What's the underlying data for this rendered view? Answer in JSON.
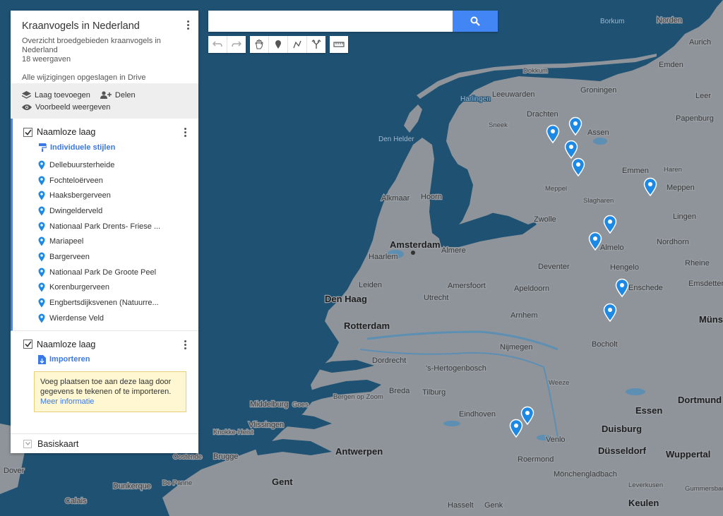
{
  "map": {
    "title": "Kraanvogels in Nederland",
    "description": "Overzicht broedgebieden kraanvogels in Nederland",
    "views": "18 weergaven",
    "saved_status": "Alle wijzigingen opgeslagen in Drive",
    "accent": "#4285f4",
    "marker_color": "#1e88e5"
  },
  "actions": {
    "add_layer": "Laag toevoegen",
    "share": "Delen",
    "preview": "Voorbeeld weergeven"
  },
  "layer1": {
    "name": "Naamloze laag",
    "style_link": "Individuele stijlen",
    "places": [
      "Dellebuursterheide",
      "Fochteloërveen",
      "Haaksbergerveen",
      "Dwingelderveld",
      "Nationaal Park Drents- Friese ...",
      "Mariapeel",
      "Bargerveen",
      "Nationaal Park De Groote Peel",
      "Korenburgerveen",
      "Engbertsdijksvenen (Natuurre...",
      "Wierdense Veld"
    ]
  },
  "layer2": {
    "name": "Naamloze laag",
    "import_link": "Importeren",
    "tip_text": "Voeg plaatsen toe aan deze laag door gegevens te tekenen of te importeren.",
    "tip_link": "Meer informatie"
  },
  "basemap": {
    "label": "Basiskaart"
  },
  "search": {
    "value": "",
    "placeholder": ""
  },
  "cities": {
    "amsterdam": "Amsterdam",
    "rotterdam": "Rotterdam",
    "den_haag": "Den Haag",
    "utrecht": "Utrecht",
    "leiden": "Leiden",
    "haarlem": "Haarlem",
    "almere": "Almere",
    "alkmaar": "Alkmaar",
    "hoorn": "Hoorn",
    "den_helder": "Den Helder",
    "leeuwarden": "Leeuwarden",
    "groningen": "Groningen",
    "drachten": "Drachten",
    "assen": "Assen",
    "emmen": "Emmen",
    "meppel": "Meppel",
    "zwolle": "Zwolle",
    "almelo": "Almelo",
    "hengelo": "Hengelo",
    "enschede": "Enschede",
    "deventer": "Deventer",
    "apeldoorn": "Apeldoorn",
    "amersfoort": "Amersfoort",
    "arnhem": "Arnhem",
    "nijmegen": "Nijmegen",
    "den_bosch": "'s-Hertogenbosch",
    "dordrecht": "Dordrecht",
    "breda": "Breda",
    "tilburg": "Tilburg",
    "eindhoven": "Eindhoven",
    "venlo": "Venlo",
    "roermond": "Roermond",
    "bergen_op_zoom": "Bergen op Zoom",
    "middelburg": "Middelburg",
    "goes": "Goes",
    "vlissingen": "Vlissingen",
    "antwerpen": "Antwerpen",
    "gent": "Gent",
    "brugge": "Brugge",
    "knokke": "Knokke-Heist",
    "oostende": "Oostende",
    "dunkerque": "Dunkerque",
    "de_panne": "De Panne",
    "calais": "Calais",
    "dover": "Dover",
    "hasselt": "Hasselt",
    "genk": "Genk",
    "essen": "Essen",
    "duisburg": "Duisburg",
    "dusseldorf": "Düsseldorf",
    "wuppertal": "Wuppertal",
    "dortmund": "Dortmund",
    "munster": "Müns",
    "monchengladbach": "Mönchengladbach",
    "leverkusen": "Leverkusen",
    "keulen": "Keulen",
    "gummersbach": "Gummersbac",
    "bocholt": "Bocholt",
    "rheine": "Rheine",
    "nordhorn": "Nordhorn",
    "lingen": "Lingen",
    "meppen": "Meppen",
    "haren": "Haren",
    "emsdetten": "Emsdetten",
    "papenburg": "Papenburg",
    "leer": "Leer",
    "emden": "Emden",
    "aurich": "Aurich",
    "norden": "Norden",
    "borkum": "Borkum",
    "sneek": "Sneek",
    "harlingen": "Harlingen",
    "dokkum": "Dokkum",
    "slagharen": "Slagharen",
    "weeze": "Weeze"
  }
}
